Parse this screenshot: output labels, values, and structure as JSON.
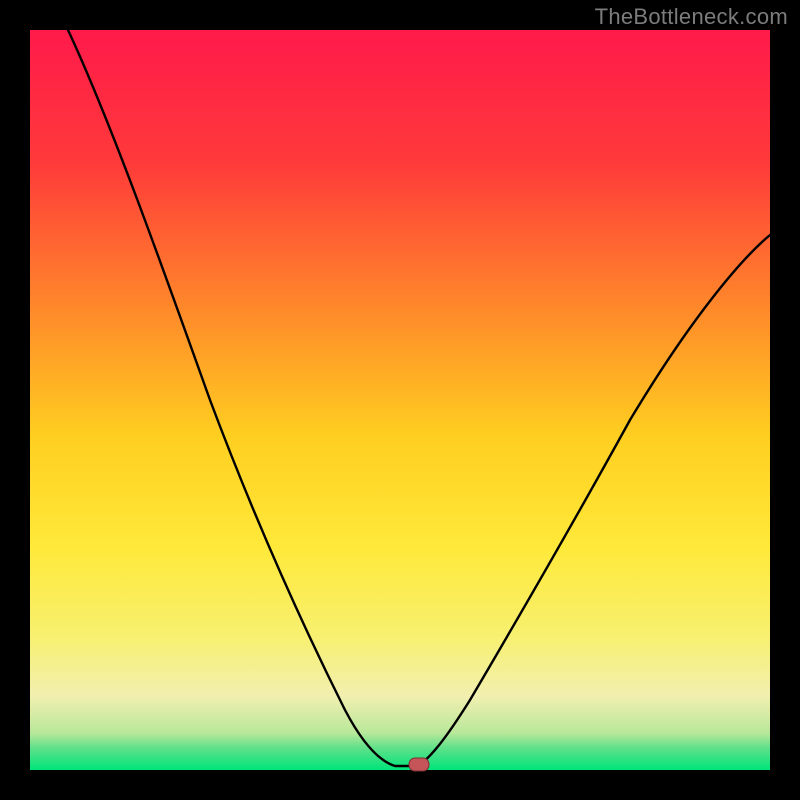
{
  "watermark": "TheBottleneck.com",
  "chart_data": {
    "type": "line",
    "title": "",
    "xlabel": "",
    "ylabel": "",
    "xlim": [
      0,
      100
    ],
    "ylim": [
      0,
      100
    ],
    "grid": false,
    "background_gradient": {
      "top": "#ff1a4a",
      "upper_mid": "#ff7a2a",
      "mid": "#ffd700",
      "lower_mid_1": "#f8f27a",
      "lower_mid_2": "#f5f0b0",
      "lower": "#77e07a",
      "bottom": "#00e57a"
    },
    "series": [
      {
        "name": "bottleneck-curve",
        "color": "#000000",
        "x": [
          0,
          5,
          10,
          15,
          20,
          25,
          30,
          35,
          40,
          45,
          48,
          50,
          52,
          53,
          55,
          60,
          65,
          70,
          75,
          80,
          85,
          90,
          95,
          100
        ],
        "y": [
          100,
          92,
          84,
          76,
          68,
          60,
          51,
          42,
          32,
          18,
          7,
          1,
          0,
          0,
          2,
          10,
          20,
          30,
          40,
          48,
          55,
          61,
          66,
          70
        ]
      }
    ],
    "marker": {
      "name": "optimal-point",
      "x": 52.5,
      "y": 0,
      "color": "#c6555a",
      "shape": "pill"
    }
  }
}
